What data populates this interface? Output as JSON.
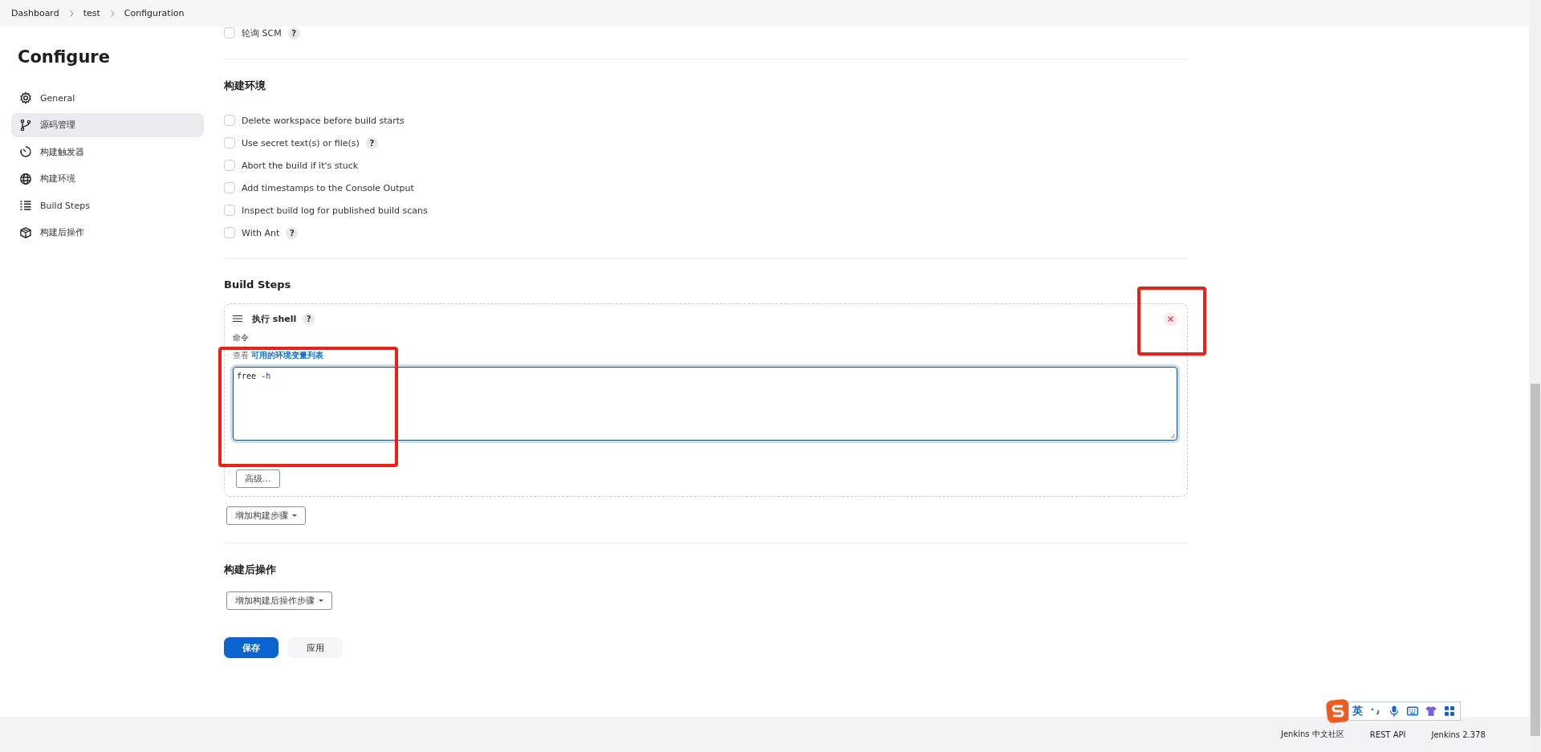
{
  "breadcrumbs": [
    "Dashboard",
    "test",
    "Configuration"
  ],
  "sidebar": {
    "title": "Configure",
    "items": [
      {
        "label": "General",
        "selected": false
      },
      {
        "label": "源码管理",
        "selected": true
      },
      {
        "label": "构建触发器",
        "selected": false
      },
      {
        "label": "构建环境",
        "selected": false
      },
      {
        "label": "Build Steps",
        "selected": false
      },
      {
        "label": "构建后操作",
        "selected": false
      }
    ]
  },
  "scm_trigger_options": [
    {
      "label": "轮询 SCM",
      "checked": false,
      "help": "?"
    }
  ],
  "build_environment": {
    "heading": "构建环境",
    "options": [
      {
        "label": "Delete workspace before build starts",
        "checked": false
      },
      {
        "label": "Use secret text(s) or file(s)",
        "checked": false,
        "help": "?"
      },
      {
        "label": "Abort the build if it's stuck",
        "checked": false
      },
      {
        "label": "Add timestamps to the Console Output",
        "checked": false
      },
      {
        "label": "Inspect build log for published build scans",
        "checked": false
      },
      {
        "label": "With Ant",
        "checked": false,
        "help": "?"
      }
    ]
  },
  "build_steps": {
    "heading": "Build Steps",
    "steps": [
      {
        "title": "执行 shell",
        "help": "?",
        "field_label": "命令",
        "hint_prefix": "查看",
        "hint_link": "可用的环境变量列表",
        "command": "free -h",
        "advanced_button": "高级..."
      }
    ],
    "add_button": "增加构建步骤"
  },
  "post_build": {
    "heading": "构建后操作",
    "add_button": "增加构建后操作步骤"
  },
  "buttons": [
    {
      "label": "保存",
      "kind": "primary"
    },
    {
      "label": "应用",
      "kind": "secondary"
    }
  ],
  "footer": [
    "Jenkins 中文社区",
    "REST API",
    "Jenkins 2.378"
  ],
  "ime_toolbar": {
    "mode": "英"
  },
  "annotations": [
    {
      "kind": "rect"
    },
    {
      "kind": "rect"
    }
  ]
}
